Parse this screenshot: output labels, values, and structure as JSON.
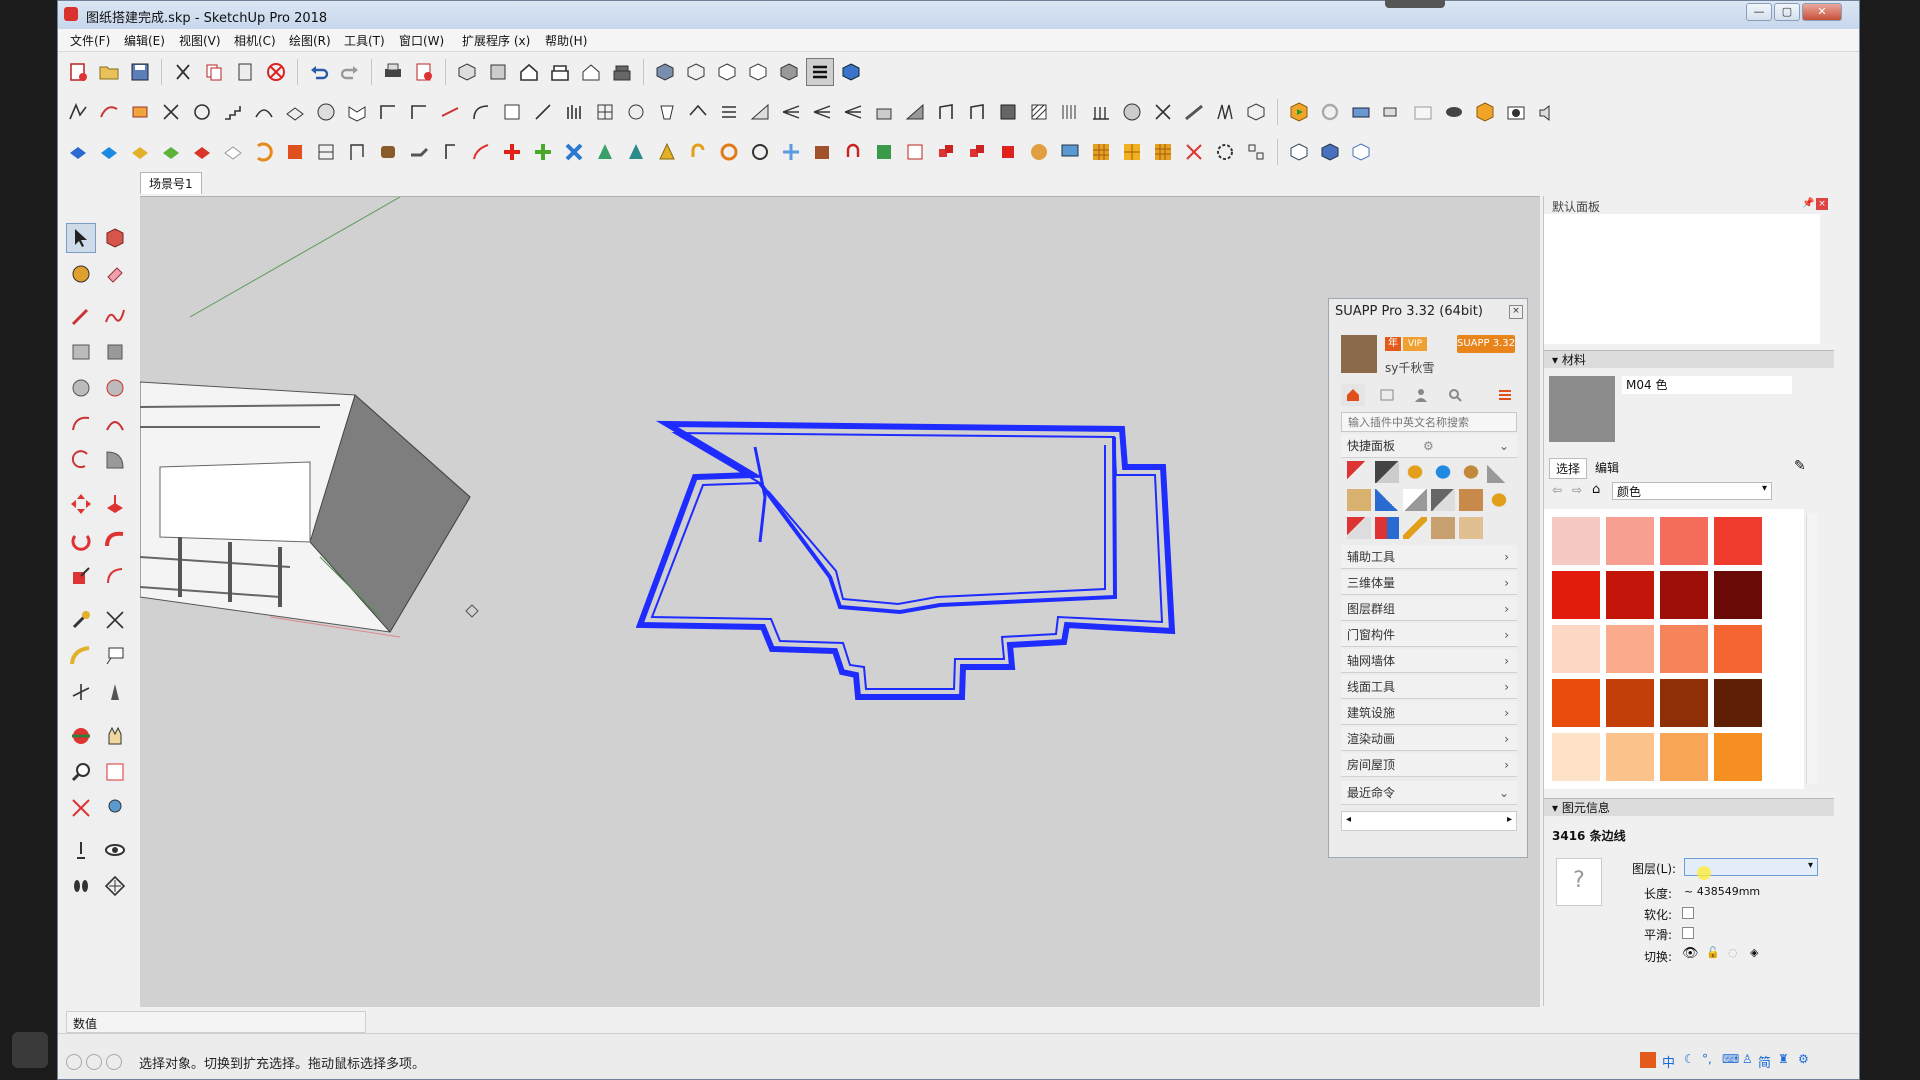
{
  "window": {
    "title": "图纸搭建完成.skp - SketchUp Pro 2018",
    "minimize": "—",
    "maximize": "▢",
    "close": "✕"
  },
  "menubar": [
    "文件(F)",
    "编辑(E)",
    "视图(V)",
    "相机(C)",
    "绘图(R)",
    "工具(T)",
    "窗口(W)",
    "扩展程序 (x)",
    "帮助(H)"
  ],
  "scene_tab": "场景号1",
  "suapp": {
    "title": "SUAPP Pro 3.32 (64bit)",
    "user": "sy千秋雪",
    "badge_year": "年",
    "badge_vip": "VIP",
    "badge_version": "SUAPP 3.32",
    "search_placeholder": "输入插件中英文名称搜索",
    "quick_panel": "快捷面板",
    "menu_items": [
      "辅助工具",
      "三维体量",
      "图层群组",
      "门窗构件",
      "轴网墙体",
      "线面工具",
      "建筑设施",
      "渲染动画",
      "房间屋顶",
      "最近命令"
    ]
  },
  "tray": {
    "default_panel": "默认面板",
    "materials": {
      "header": "材料",
      "material_name": "M04 色",
      "tab_select": "选择",
      "tab_edit": "编辑",
      "collection": "颜色",
      "swatches": [
        "#f7c9c3",
        "#f7a092",
        "#f46d5c",
        "#ee3b2d",
        "#e31b0d",
        "#c4150b",
        "#9c1009",
        "#690a06",
        "#fbd7c4",
        "#f9ab8b",
        "#f6845a",
        "#f36531",
        "#e84b0c",
        "#c23f0a",
        "#8f2f08",
        "#5e1f06",
        "#fde2c8",
        "#fbc38b",
        "#f8a656",
        "#f58f22",
        "#e8790a",
        "#c86507",
        "#9a4e05",
        "#6a3603"
      ]
    },
    "entity_info": {
      "header": "图元信息",
      "summary": "3416 条边线",
      "layer_label": "图层(L):",
      "length_label": "长度:",
      "length_value": "~ 438549mm",
      "soften_label": "软化:",
      "smooth_label": "平滑:",
      "toggle_label": "切换:",
      "unknown_icon": "?"
    }
  },
  "vcb_label": "数值",
  "status_text": "选择对象。切换到扩充选择。拖动鼠标选择多项。",
  "ime_chars": [
    "中",
    "简"
  ]
}
